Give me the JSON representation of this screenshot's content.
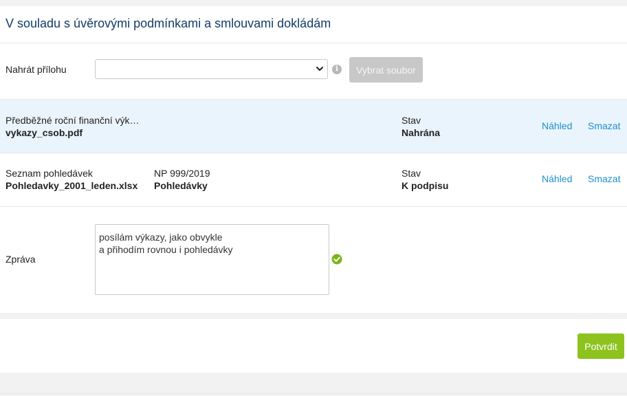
{
  "form": {
    "title": "V souladu s úvěrovými podmínkami a smlouvami dokládám",
    "upload": {
      "label": "Nahrát přílohu",
      "selected_value": "",
      "info_icon": "info-icon",
      "choose_button": "Vybrat soubor"
    },
    "attachments": [
      {
        "type": "Předběžné roční finanční výk…",
        "filename": "vykazy_csob.pdf",
        "reference": "",
        "reference_detail": "",
        "status_label": "Stav",
        "status": "Nahrána",
        "preview": "Náhled",
        "delete": "Smazat"
      },
      {
        "type": "Seznam pohledávek",
        "filename": "Pohledavky_2001_leden.xlsx",
        "reference": "NP 999/2019",
        "reference_detail": "Pohledávky",
        "status_label": "Stav",
        "status": "K podpisu",
        "preview": "Náhled",
        "delete": "Smazat"
      }
    ],
    "message": {
      "label": "Zpráva",
      "lines": [
        "posílám výkazy, jako obvykle",
        "a přihodím rovnou i pohledávky"
      ],
      "valid_icon": "check-circle-icon"
    }
  },
  "footer": {
    "confirm_button": "Potvrdit"
  },
  "colors": {
    "title": "#123c69",
    "link": "#1f8fcf",
    "highlight_row": "#eaf4fc",
    "confirm": "#8dc21f",
    "disabled_button": "#c8c8c8",
    "valid": "#7cb518"
  }
}
